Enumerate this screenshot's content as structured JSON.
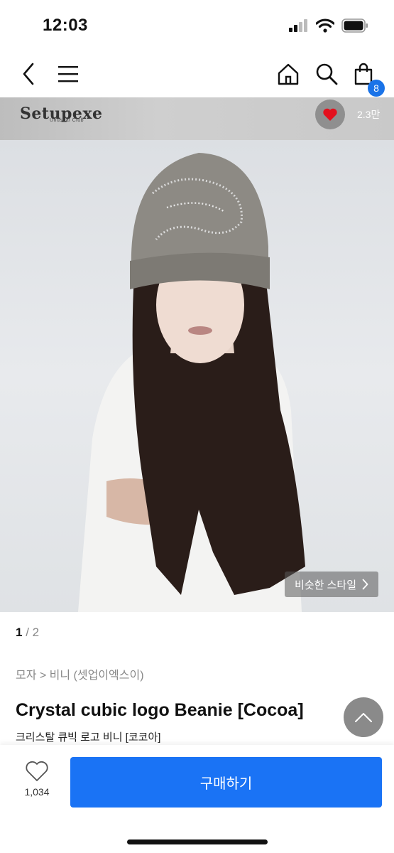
{
  "status": {
    "time": "12:03"
  },
  "nav": {
    "cart_count": "8"
  },
  "brand": {
    "name": "Setupexe",
    "tagline": "Unusual Club",
    "like_count": "2.3만"
  },
  "hero": {
    "similar_label": "비슷한 스타일"
  },
  "pager": {
    "current": "1",
    "separator": " / ",
    "total": "2"
  },
  "product": {
    "breadcrumb": "모자 > 비니 (셋업이엑스이)",
    "title": "Crystal cubic logo Beanie [Cocoa]",
    "subtitle": "크리스탈 큐빅 로고 비니 [코코아]"
  },
  "bottom": {
    "wish_count": "1,034",
    "buy_label": "구매하기"
  },
  "colors": {
    "accent": "#1a73f5",
    "heart": "#e3101d"
  }
}
